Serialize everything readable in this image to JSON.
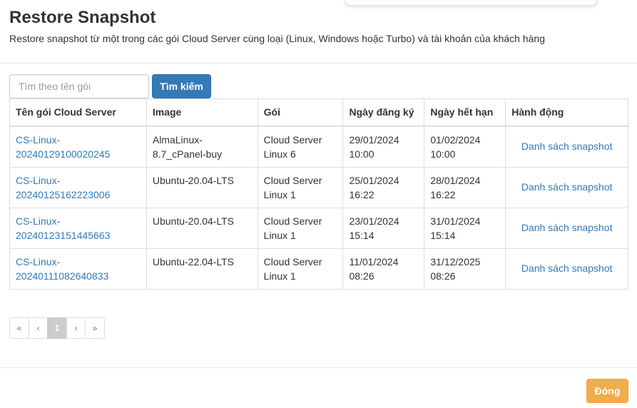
{
  "modal": {
    "title": "Restore Snapshot",
    "subtitle": "Restore snapshot từ một trong các gói Cloud Server cùng loại (Linux, Windows hoặc Turbo) và tài khoản của khách hàng"
  },
  "search": {
    "placeholder": "Tìm theo tên gói",
    "value": "",
    "button_label": "Tìm kiếm"
  },
  "table": {
    "headers": [
      "Tên gói Cloud Server",
      "Image",
      "Gói",
      "Ngày đăng ký",
      "Ngày hết hạn",
      "Hành động"
    ],
    "rows": [
      {
        "name_line1": "CS-Linux-",
        "name_line2": "20240129100020245",
        "image_line1": "AlmaLinux-",
        "image_line2": "8.7_cPanel-buy",
        "plan_line1": "Cloud Server",
        "plan_line2": "Linux 6",
        "reg_date": "29/01/2024",
        "reg_time": "10:00",
        "exp_date": "01/02/2024",
        "exp_time": "10:00",
        "action": "Danh sách snapshot"
      },
      {
        "name_line1": "CS-Linux-",
        "name_line2": "20240125162223006",
        "image_line1": "Ubuntu-20.04-LTS",
        "image_line2": "",
        "plan_line1": "Cloud Server",
        "plan_line2": "Linux 1",
        "reg_date": "25/01/2024",
        "reg_time": "16:22",
        "exp_date": "28/01/2024",
        "exp_time": "16:22",
        "action": "Danh sách snapshot"
      },
      {
        "name_line1": "CS-Linux-",
        "name_line2": "20240123151445663",
        "image_line1": "Ubuntu-20.04-LTS",
        "image_line2": "",
        "plan_line1": "Cloud Server",
        "plan_line2": "Linux 1",
        "reg_date": "23/01/2024",
        "reg_time": "15:14",
        "exp_date": "31/01/2024",
        "exp_time": "15:14",
        "action": "Danh sách snapshot"
      },
      {
        "name_line1": "CS-Linux-",
        "name_line2": "20240111082640833",
        "image_line1": "Ubuntu-22.04-LTS",
        "image_line2": "",
        "plan_line1": "Cloud Server",
        "plan_line2": "Linux 1",
        "reg_date": "11/01/2024",
        "reg_time": "08:26",
        "exp_date": "31/12/2025",
        "exp_time": "08:26",
        "action": "Danh sách snapshot"
      }
    ]
  },
  "pagination": {
    "first": "«",
    "prev": "‹",
    "current": "1",
    "next": "›",
    "last": "»"
  },
  "footer": {
    "close_label": "Đóng"
  },
  "colors": {
    "primary": "#337ab7",
    "link": "#337ab7",
    "warning": "#f0ad4e",
    "border": "#dddddd",
    "text": "#333333"
  }
}
